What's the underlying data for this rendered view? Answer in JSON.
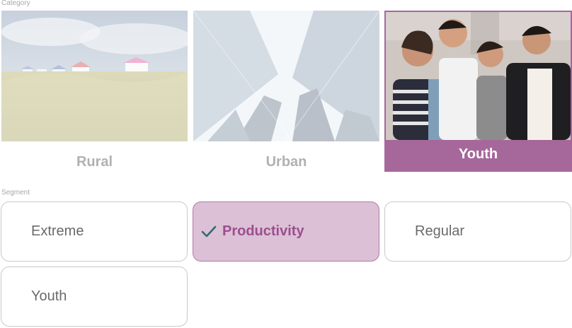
{
  "category": {
    "label": "Category",
    "tiles": [
      {
        "caption": "Rural",
        "selected": false
      },
      {
        "caption": "Urban",
        "selected": false
      },
      {
        "caption": "Youth",
        "selected": true
      }
    ]
  },
  "segment": {
    "label": "Segment",
    "options": [
      {
        "label": "Extreme",
        "selected": false
      },
      {
        "label": "Productivity",
        "selected": true
      },
      {
        "label": "Regular",
        "selected": false
      },
      {
        "label": "Youth",
        "selected": false
      }
    ]
  },
  "colors": {
    "accent": "#a6679b",
    "accent_light": "#dcc0d6",
    "accent_text": "#9c4f8e",
    "check": "#2e6b72"
  },
  "icons": {
    "selected_segment": "checkmark-icon"
  }
}
